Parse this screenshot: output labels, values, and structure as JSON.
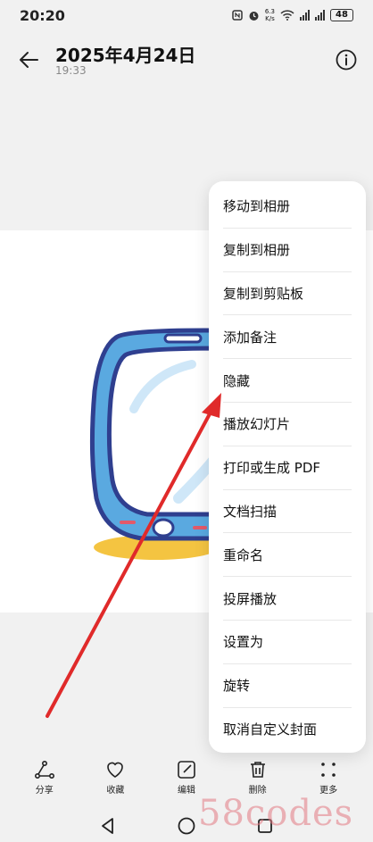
{
  "status_bar": {
    "time": "20:20",
    "speed_value": "6.3",
    "speed_unit": "K/s",
    "battery": "48"
  },
  "header": {
    "title": "2025年4月24日",
    "subtitle": "19:33"
  },
  "menu": {
    "items": [
      "移动到相册",
      "复制到相册",
      "复制到剪贴板",
      "添加备注",
      "隐藏",
      "播放幻灯片",
      "打印或生成 PDF",
      "文档扫描",
      "重命名",
      "投屏播放",
      "设置为",
      "旋转",
      "取消自定义封面"
    ]
  },
  "toolbar": {
    "share": "分享",
    "favorite": "收藏",
    "edit": "编辑",
    "delete": "删除",
    "more": "更多"
  },
  "watermark": "58codes",
  "colors": {
    "annotation_arrow": "#e02a2a",
    "phone_frame": "#2f3f8f",
    "phone_body": "#5aa9e0"
  }
}
